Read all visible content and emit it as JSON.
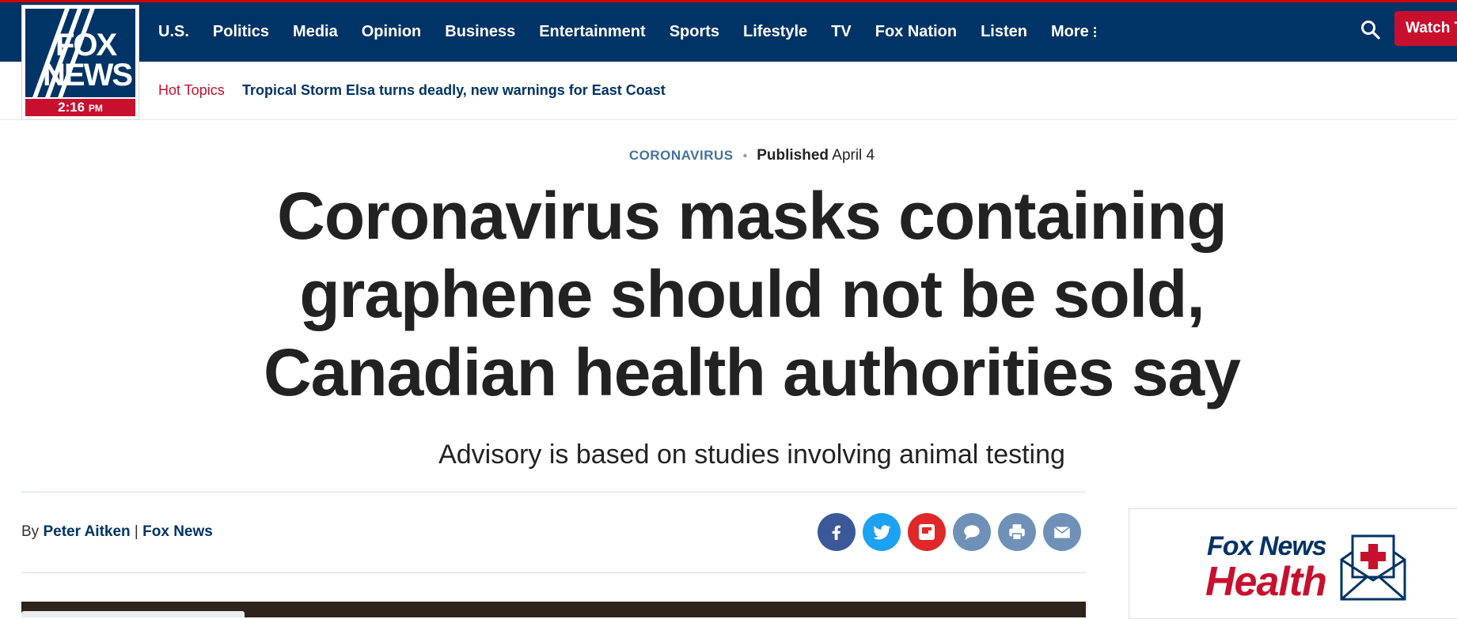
{
  "colors": {
    "brand_navy": "#003366",
    "accent_red": "#c8102e",
    "category_blue": "#47719e"
  },
  "logo": {
    "line1": "FOX",
    "line2": "NEWS",
    "time": "2:16",
    "meridiem": "PM"
  },
  "nav": {
    "items": [
      "U.S.",
      "Politics",
      "Media",
      "Opinion",
      "Business",
      "Entertainment",
      "Sports",
      "Lifestyle",
      "TV",
      "Fox Nation",
      "Listen"
    ],
    "more_label": "More",
    "watch_label": "Watch T"
  },
  "hot_topics": {
    "label": "Hot Topics",
    "link": "Tropical Storm Elsa turns deadly, new warnings for East Coast"
  },
  "article": {
    "category": "CORONAVIRUS",
    "published_label": "Published",
    "published_date": "April 4",
    "headline": "Coronavirus masks containing graphene should not be sold, Canadian health authorities say",
    "dek": "Advisory is based on studies involving animal testing",
    "byline_prefix": "By",
    "author": "Peter Aitken",
    "separator": "|",
    "source": "Fox News"
  },
  "share_buttons": [
    {
      "name": "facebook-icon",
      "glyph": "f",
      "color": "#3b5998"
    },
    {
      "name": "twitter-icon",
      "glyph": "t",
      "color": "#1da1f2"
    },
    {
      "name": "flipboard-icon",
      "glyph": "F",
      "color": "#e12828"
    },
    {
      "name": "comment-icon",
      "glyph": "c",
      "color": "#6f91b8"
    },
    {
      "name": "print-icon",
      "glyph": "p",
      "color": "#6f91b8"
    },
    {
      "name": "email-icon",
      "glyph": "e",
      "color": "#6f91b8"
    }
  ],
  "promo": {
    "line1": "Fox News",
    "line2": "Health"
  }
}
